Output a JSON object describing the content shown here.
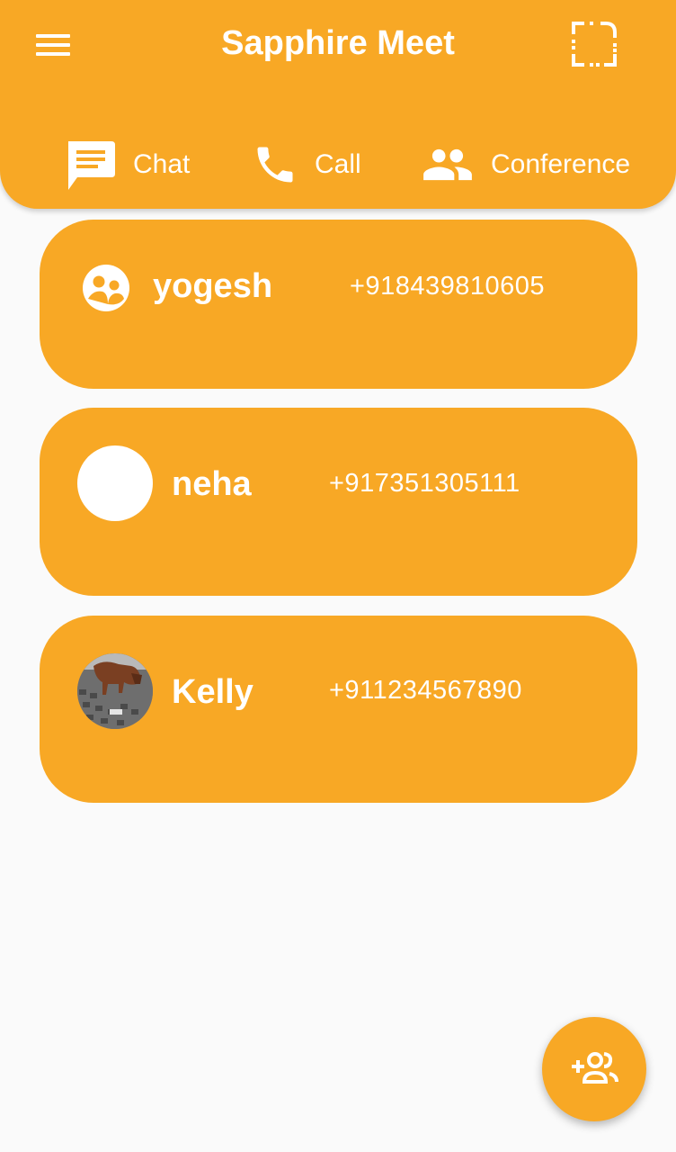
{
  "app": {
    "title": "Sapphire Meet",
    "accent_color": "#f8a825",
    "menu_icon": "menu-icon",
    "action_icon": "crop-free-icon"
  },
  "tabs": [
    {
      "label": "Chat",
      "icon": "chat-icon"
    },
    {
      "label": "Call",
      "icon": "phone-icon"
    },
    {
      "label": "Conference",
      "icon": "group-icon"
    }
  ],
  "contacts": [
    {
      "name": "yogesh",
      "phone": "+918439810605",
      "avatar": "default-avatar-icon"
    },
    {
      "name": "neha",
      "phone": "+917351305111",
      "avatar": "blank-avatar"
    },
    {
      "name": "Kelly",
      "phone": "+911234567890",
      "avatar": "photo-avatar"
    }
  ],
  "fab": {
    "icon": "add-contact-icon"
  }
}
